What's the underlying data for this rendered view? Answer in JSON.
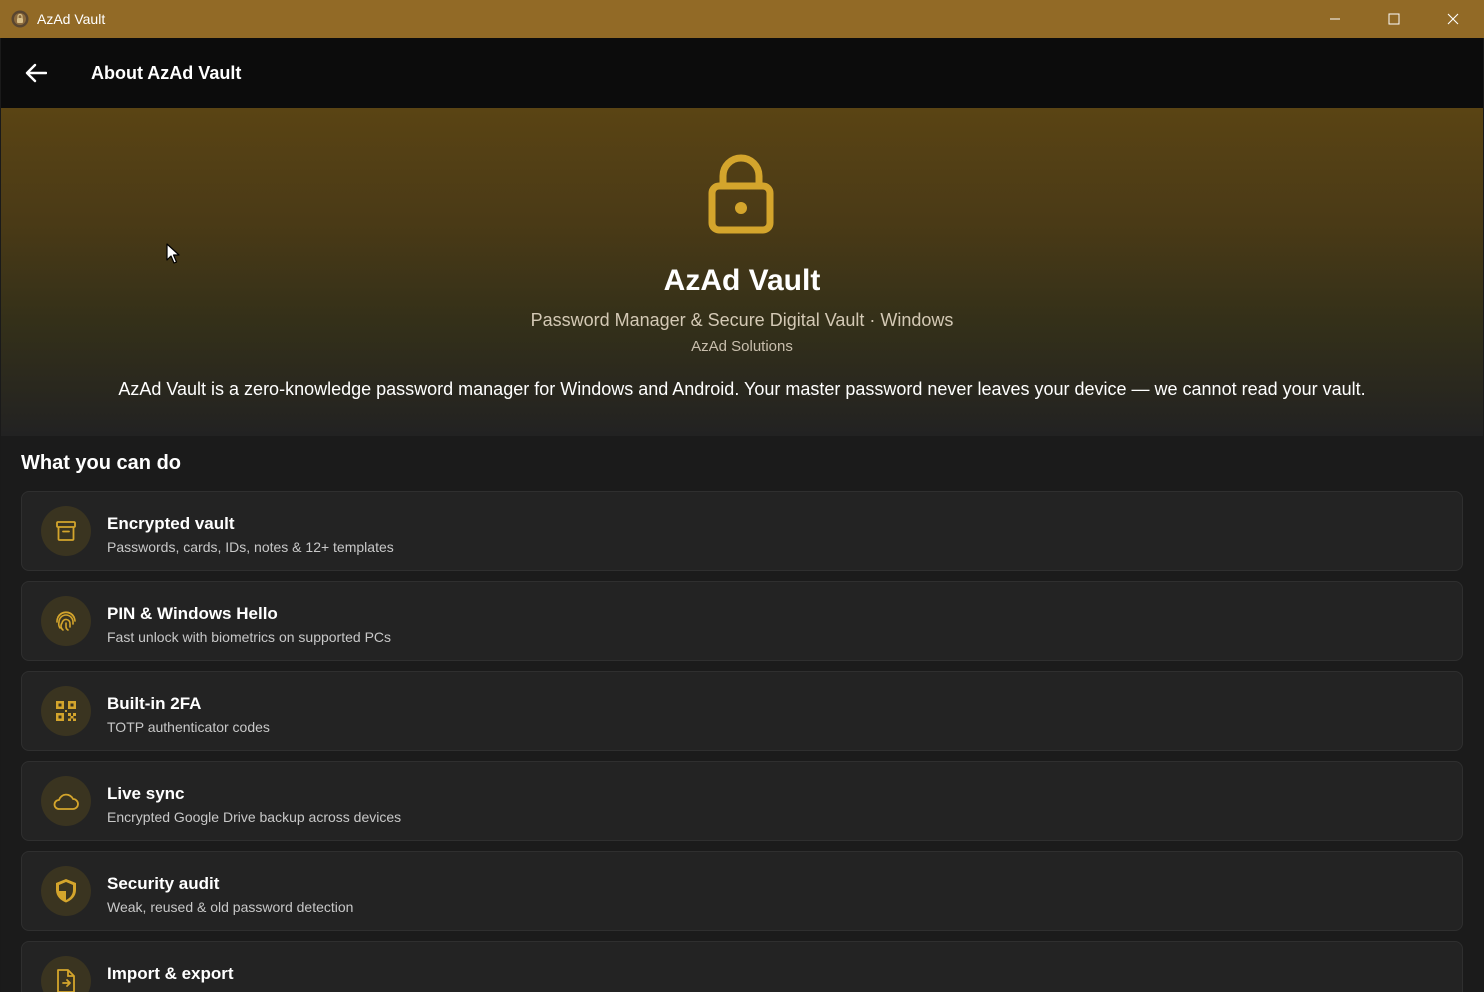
{
  "window": {
    "title": "AzAd Vault"
  },
  "appbar": {
    "title": "About AzAd Vault"
  },
  "hero": {
    "title": "AzAd Vault",
    "subtitle": "Password Manager & Secure Digital Vault · Windows",
    "company": "AzAd Solutions",
    "description": "AzAd Vault is a zero-knowledge password manager for Windows and Android. Your master password never leaves your device — we cannot read your vault."
  },
  "features": {
    "section_title": "What you can do",
    "items": [
      {
        "icon": "archive-icon",
        "title": "Encrypted vault",
        "subtitle": "Passwords, cards, IDs, notes & 12+ templates"
      },
      {
        "icon": "fingerprint-icon",
        "title": "PIN & Windows Hello",
        "subtitle": "Fast unlock with biometrics on supported PCs"
      },
      {
        "icon": "qr-code-icon",
        "title": "Built-in 2FA",
        "subtitle": "TOTP authenticator codes"
      },
      {
        "icon": "cloud-icon",
        "title": "Live sync",
        "subtitle": "Encrypted Google Drive backup across devices"
      },
      {
        "icon": "shield-icon",
        "title": "Security audit",
        "subtitle": "Weak, reused & old password detection"
      },
      {
        "icon": "file-export-icon",
        "title": "Import & export",
        "subtitle": ""
      }
    ]
  },
  "colors": {
    "titlebar": "#926a26",
    "accent": "#d4a52c",
    "icon_bg": "#3a3420"
  }
}
